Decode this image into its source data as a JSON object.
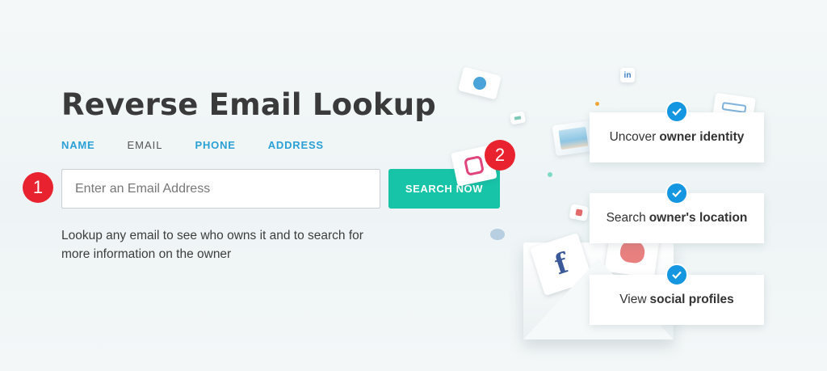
{
  "title": "Reverse Email Lookup",
  "tabs": [
    {
      "label": "NAME",
      "active": false
    },
    {
      "label": "EMAIL",
      "active": true
    },
    {
      "label": "PHONE",
      "active": false
    },
    {
      "label": "ADDRESS",
      "active": false
    }
  ],
  "search": {
    "placeholder": "Enter an Email Address",
    "value": "",
    "button_label": "SEARCH NOW"
  },
  "description": "Lookup any email to see who owns it and to search for more information on the owner",
  "step_badges": [
    "1",
    "2"
  ],
  "features": [
    {
      "prefix": "Uncover",
      "bold": "owner identity",
      "icon": "check-icon"
    },
    {
      "prefix": "Search",
      "bold": "owner's location",
      "icon": "check-icon"
    },
    {
      "prefix": "View",
      "bold": "social profiles",
      "icon": "check-icon"
    }
  ],
  "decor_tiles": {
    "linkedin_text": "in",
    "facebook_text": "f"
  },
  "colors": {
    "accent_teal": "#17c4a8",
    "link_blue": "#2aa0d6",
    "badge_red": "#e8222f",
    "check_blue": "#1596e0",
    "title_dark": "#3a3a3a"
  }
}
